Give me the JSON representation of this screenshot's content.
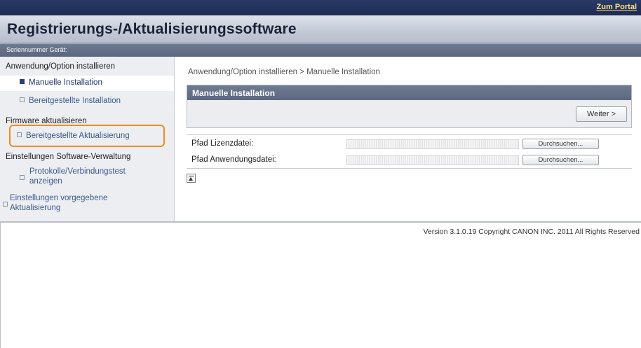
{
  "header": {
    "portal_link": "Zum Portal",
    "title": "Registrierungs-/Aktualisierungssoftware",
    "serial_label": "Seriennummer Gerät:"
  },
  "sidebar": {
    "section_install": "Anwendung/Option installieren",
    "item_manual": "Manuelle Installation",
    "item_provided_install": "Bereitgestellte Installation",
    "section_firmware": "Firmware aktualisieren",
    "item_provided_update": "Bereitgestellte Aktualisierung",
    "section_settings": "Einstellungen Software-Verwaltung",
    "item_logs_line1": "Protokolle/Verbindungstest",
    "item_logs_line2": "anzeigen",
    "item_preset_line1": "Einstellungen vorgegebene",
    "item_preset_line2": "Aktualisierung"
  },
  "main": {
    "breadcrumb": "Anwendung/Option installieren > Manuelle Installation",
    "panel_title": "Manuelle Installation",
    "next_button": "Weiter >",
    "license_label": "Pfad Lizenzdatei:",
    "app_label": "Pfad Anwendungsdatei:",
    "browse_label": "Durchsuchen...",
    "top_icon": "arrow-to-top-icon"
  },
  "footer": {
    "version": "Version 3.1.0.19 Copyright CANON INC. 2011 All Rights Reserved"
  },
  "colors": {
    "header_bar": "#1e2b52",
    "portal_link": "#ffe27a",
    "highlight": "#f08a24",
    "panel_header": "#5c687f"
  }
}
